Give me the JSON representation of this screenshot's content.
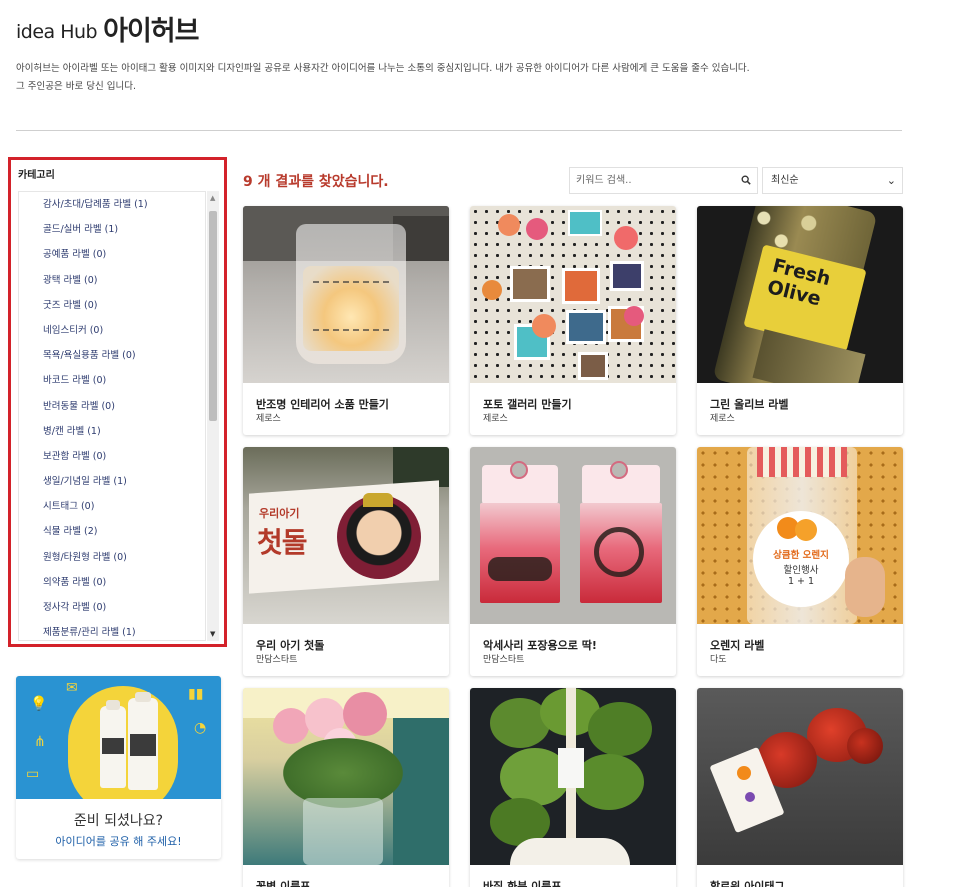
{
  "header": {
    "logo_en": "idea Hub",
    "logo_ko": "아이허브",
    "description_line1": "아이허브는 아이라벨 또는 아이태그 활용 이미지와 디자인파일 공유로 사용자간 아이디어를 나누는 소통의 중심지입니다. 내가 공유한 아이디어가 다른 사람에게 큰 도움을 줄수 있습니다.",
    "description_line2": "그 주인공은 바로 당신 입니다."
  },
  "sidebar": {
    "category_title": "카테고리",
    "items": [
      {
        "label": "감사/초대/답례품 라벨 (1)"
      },
      {
        "label": "골드/실버 라벨 (1)"
      },
      {
        "label": "공예품 라벨 (0)"
      },
      {
        "label": "광택 라벨 (0)"
      },
      {
        "label": "굿즈 라벨 (0)"
      },
      {
        "label": "네임스티커 (0)"
      },
      {
        "label": "목욕/욕실용품 라벨 (0)"
      },
      {
        "label": "바코드 라벨 (0)"
      },
      {
        "label": "반려동물 라벨 (0)"
      },
      {
        "label": "병/캔 라벨 (1)"
      },
      {
        "label": "보관함 라벨 (0)"
      },
      {
        "label": "생일/기념일 라벨 (1)"
      },
      {
        "label": "시트태그 (0)"
      },
      {
        "label": "식물 라벨 (2)"
      },
      {
        "label": "원형/타원형 라벨 (0)"
      },
      {
        "label": "의약품 라벨 (0)"
      },
      {
        "label": "정사각 라벨 (0)"
      },
      {
        "label": "제품분류/관리 라벨 (1)"
      }
    ]
  },
  "promo": {
    "title": "준비 되셨나요?",
    "subtitle": "아이디어를 공유 해 주세요!"
  },
  "results": {
    "count_text": "9 개 결과를 찾았습니다.",
    "search_placeholder": "키워드 검색..",
    "sort_selected": "최신순"
  },
  "cards": [
    {
      "title": "반조명 인테리어 소품 만들기",
      "brand": "제로스"
    },
    {
      "title": "포토 갤러리 만들기",
      "brand": "제로스"
    },
    {
      "title": "그린 올리브 라벨",
      "brand": "제로스"
    },
    {
      "title": "우리 아기 첫돌",
      "brand": "만담스타트"
    },
    {
      "title": "악세사리 포장용으로 딱!",
      "brand": "만담스타트"
    },
    {
      "title": "오렌지 라벨",
      "brand": "다도"
    },
    {
      "title": "꽃병 이름표",
      "brand": ""
    },
    {
      "title": "바질 화분 이름표",
      "brand": ""
    },
    {
      "title": "할로윈 아이태그",
      "brand": ""
    }
  ],
  "image_text": {
    "olive_line1": "Fresh",
    "olive_line2": "Olive",
    "dol_text": "첫돌",
    "dol_sub": "우리아기",
    "orange_line1": "상큼한 오렌지",
    "orange_line2": "할인행사",
    "orange_line3": "1 + 1"
  },
  "colors": {
    "accent_red": "#d3222a",
    "result_text": "#b83a2c",
    "category_text": "#2c3a6e",
    "promo_blue": "#2a93d2",
    "promo_yellow": "#f4d43a"
  }
}
